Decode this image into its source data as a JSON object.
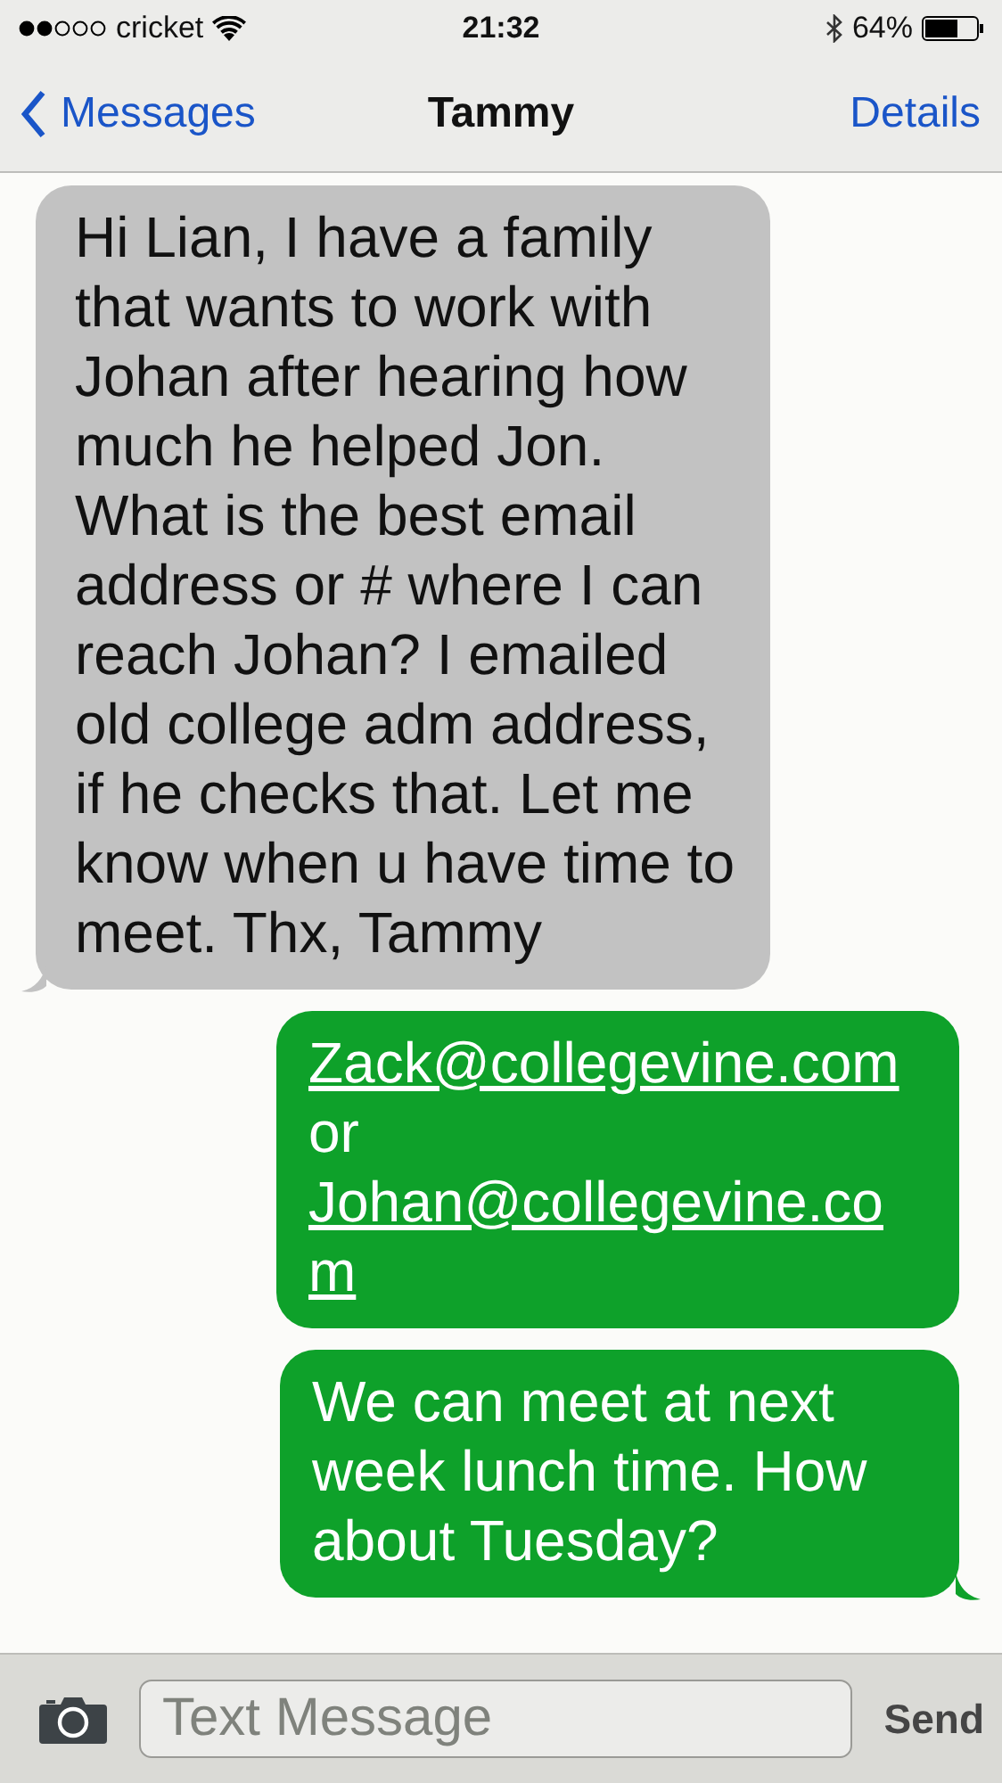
{
  "status_bar": {
    "carrier": "cricket",
    "time": "21:32",
    "battery": "64%"
  },
  "nav_bar": {
    "back": "Messages",
    "title": "Tammy",
    "action": "Details"
  },
  "messages": [
    {
      "kind": "incoming",
      "parts": [
        {
          "text": "Hi Lian, I have a family that wants to work with Johan after hearing how much he helped Jon. What is the best email address or # where I can reach Johan? I emailed old college adm address, if he checks that. Let me know when u have time to meet. Thx, Tammy",
          "link": false
        }
      ],
      "tail": true
    },
    {
      "kind": "outgoing",
      "parts": [
        {
          "text": "Zack@collegevine.com",
          "link": true
        },
        {
          "text": "or",
          "link": false
        },
        {
          "text": "Johan@collegevine.com",
          "link": true
        }
      ],
      "tail": false
    },
    {
      "kind": "outgoing",
      "parts": [
        {
          "text": "We can meet at next week lunch time. How about Tuesday?",
          "link": false
        }
      ],
      "tail": true
    }
  ],
  "input_bar": {
    "placeholder": "Text Message",
    "send": "Send"
  }
}
